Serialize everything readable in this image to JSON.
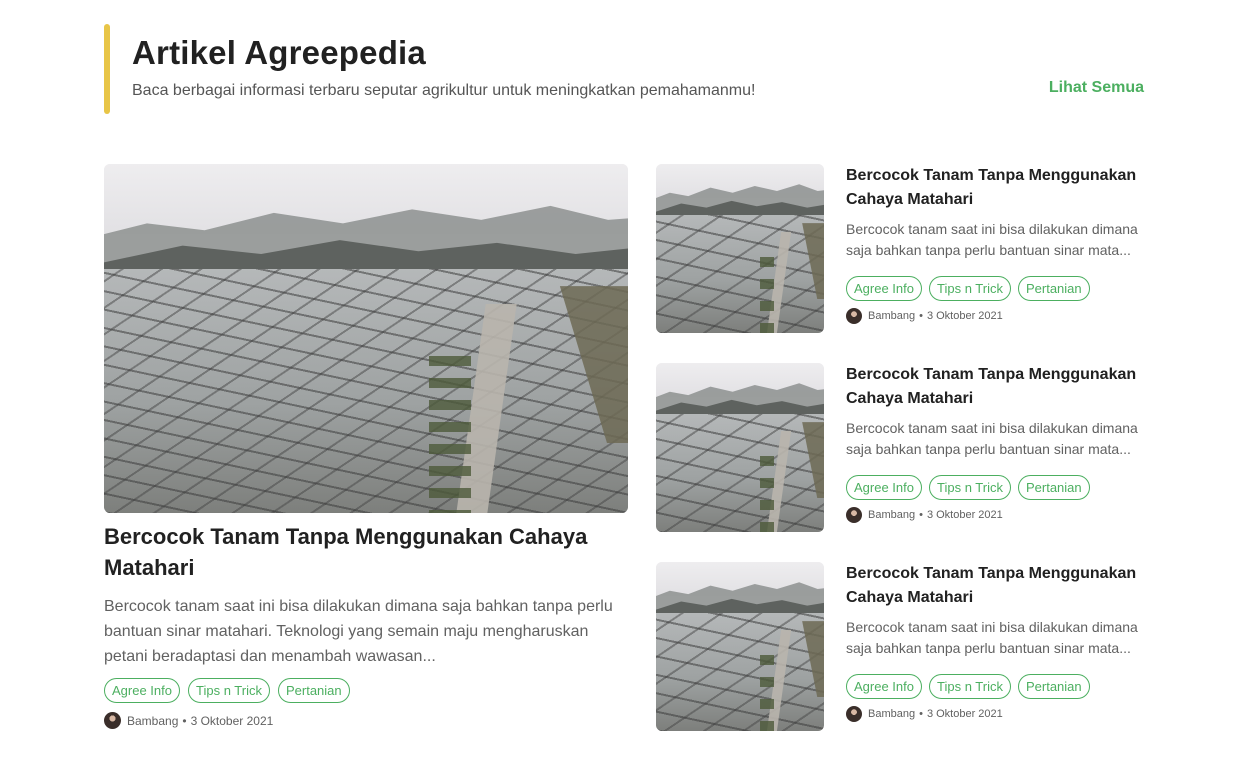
{
  "section": {
    "title": "Artikel Agreepedia",
    "subtitle": "Baca berbagai informasi terbaru seputar agrikultur untuk meningkatkan pemahamanmu!",
    "see_all_label": "Lihat Semua",
    "accent_color": "#e8c547",
    "link_color": "#4caf60"
  },
  "main_article": {
    "title": "Bercocok Tanam Tanpa Menggunakan Cahaya Matahari",
    "excerpt": "Bercocok tanam saat ini bisa dilakukan dimana saja bahkan tanpa perlu bantuan sinar matahari. Teknologi yang semain maju mengharuskan petani beradaptasi dan menambah wawasan...",
    "tags": [
      "Agree Info",
      "Tips n Trick",
      "Pertanian"
    ],
    "author": "Bambang",
    "separator": "•",
    "date": "3 Oktober 2021"
  },
  "side_articles": [
    {
      "title": "Bercocok Tanam Tanpa Menggunakan Cahaya Matahari",
      "excerpt": "Bercocok tanam saat ini bisa dilakukan dimana saja bahkan tanpa perlu bantuan sinar mata...",
      "tags": [
        "Agree Info",
        "Tips n Trick",
        "Pertanian"
      ],
      "author": "Bambang",
      "separator": "•",
      "date": "3 Oktober 2021"
    },
    {
      "title": "Bercocok Tanam Tanpa Menggunakan Cahaya Matahari",
      "excerpt": "Bercocok tanam saat ini bisa dilakukan dimana saja bahkan tanpa perlu bantuan sinar mata...",
      "tags": [
        "Agree Info",
        "Tips n Trick",
        "Pertanian"
      ],
      "author": "Bambang",
      "separator": "•",
      "date": "3 Oktober 2021"
    },
    {
      "title": "Bercocok Tanam Tanpa Menggunakan Cahaya Matahari",
      "excerpt": "Bercocok tanam saat ini bisa dilakukan dimana saja bahkan tanpa perlu bantuan sinar mata...",
      "tags": [
        "Agree Info",
        "Tips n Trick",
        "Pertanian"
      ],
      "author": "Bambang",
      "separator": "•",
      "date": "3 Oktober 2021"
    }
  ]
}
